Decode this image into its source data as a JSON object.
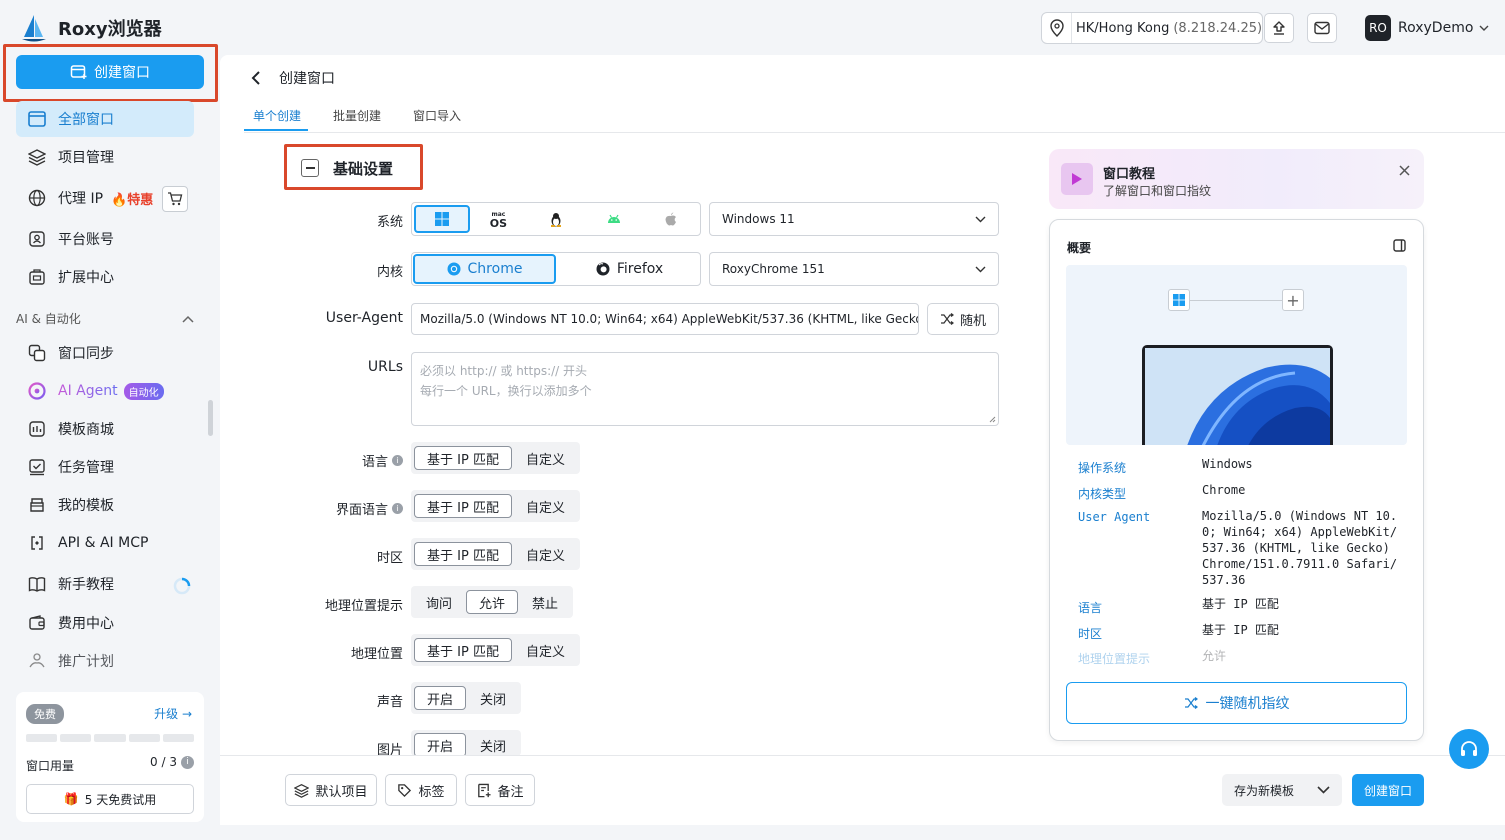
{
  "app": {
    "name": "Roxy浏览器"
  },
  "topbar": {
    "location": "HK/Hong Kong",
    "ip": "(8.218.24.25)",
    "avatar": "RO",
    "user": "RoxyDemo"
  },
  "sidebar": {
    "create_button": "创建窗口",
    "items": [
      {
        "label": "全部窗口"
      },
      {
        "label": "项目管理"
      },
      {
        "label": "代理 IP",
        "badge": "特惠"
      },
      {
        "label": "平台账号"
      },
      {
        "label": "扩展中心"
      }
    ],
    "section_title": "AI & 自动化",
    "ai_items": [
      {
        "label": "窗口同步"
      },
      {
        "label": "AI Agent",
        "badge": "自动化"
      },
      {
        "label": "模板商城"
      },
      {
        "label": "任务管理"
      },
      {
        "label": "我的模板"
      },
      {
        "label": "API & AI MCP"
      },
      {
        "label": "新手教程"
      },
      {
        "label": "费用中心"
      },
      {
        "label": "推广计划"
      }
    ],
    "plan": {
      "tier": "免费",
      "upgrade": "升级 →",
      "usage_label": "窗口用量",
      "usage_value": "0 / 3",
      "usage_fraction": 0,
      "trial_button": "5 天免费试用"
    }
  },
  "page": {
    "title": "创建窗口",
    "tabs": [
      "单个创建",
      "批量创建",
      "窗口导入"
    ],
    "active_tab": 0,
    "section_title": "基础设置"
  },
  "form": {
    "system_label": "系统",
    "system_options": [
      "windows-icon",
      "macos-icon",
      "linux-icon",
      "android-icon",
      "ios-icon"
    ],
    "system_value": "Windows 11",
    "kernel_label": "内核",
    "kernel_options": [
      "Chrome",
      "Firefox"
    ],
    "kernel_value": "RoxyChrome 151",
    "ua_label": "User-Agent",
    "ua_value": "Mozilla/5.0 (Windows NT 10.0; Win64; x64) AppleWebKit/537.36 (KHTML, like Gecko...",
    "random_button": "随机",
    "urls_label": "URLs",
    "urls_placeholder_1": "必须以 http:// 或 https:// 开头",
    "urls_placeholder_2": "每行一个 URL，换行以添加多个",
    "language_label": "语言",
    "ui_language_label": "界面语言",
    "timezone_label": "时区",
    "geo_prompt_label": "地理位置提示",
    "geo_label": "地理位置",
    "sound_label": "声音",
    "image_label": "图片",
    "opt_ip": "基于 IP 匹配",
    "opt_custom": "自定义",
    "opt_ask": "询问",
    "opt_allow": "允许",
    "opt_deny": "禁止",
    "opt_on": "开启",
    "opt_off": "关闭"
  },
  "tutorial": {
    "title": "窗口教程",
    "subtitle": "了解窗口和窗口指纹"
  },
  "summary": {
    "title": "概要",
    "rows": [
      {
        "k": "操作系统",
        "v": "Windows"
      },
      {
        "k": "内核类型",
        "v": "Chrome"
      },
      {
        "k": "User Agent",
        "v": "Mozilla/5.0 (Windows NT 10.0; Win64; x64) AppleWebKit/537.36 (KHTML, like Gecko) Chrome/151.0.7911.0 Safari/537.36"
      },
      {
        "k": "语言",
        "v": "基于 IP 匹配"
      },
      {
        "k": "时区",
        "v": "基于 IP 匹配"
      },
      {
        "k": "地理位置提示",
        "v": "允许"
      }
    ],
    "random_button": "一键随机指纹"
  },
  "footer": {
    "default_project": "默认项目",
    "tag": "标签",
    "note": "备注",
    "save_template": "存为新模板",
    "create": "创建窗口"
  },
  "colors": {
    "accent": "#1a9cf0",
    "highlight": "#d9482b"
  }
}
